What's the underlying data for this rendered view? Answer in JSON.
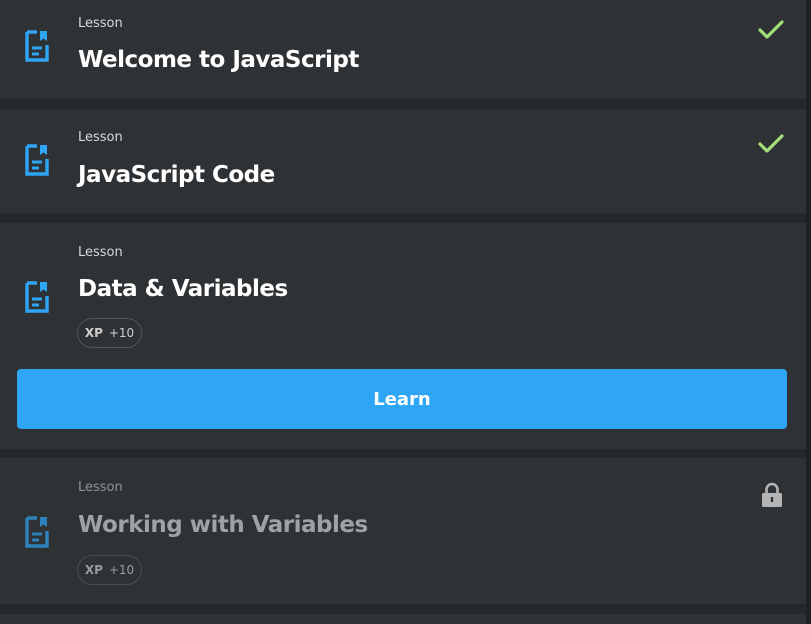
{
  "colors": {
    "accent": "#2fa5f6",
    "check": "#a3e07a",
    "lock": "#b5b5b5",
    "card": "#2e3235",
    "background": "#25282b"
  },
  "lessons": [
    {
      "kind": "Lesson",
      "title": "Welcome to JavaScript",
      "status": "completed",
      "status_icon": "check-icon"
    },
    {
      "kind": "Lesson",
      "title": "JavaScript Code",
      "status": "completed",
      "status_icon": "check-icon"
    },
    {
      "kind": "Lesson",
      "title": "Data & Variables",
      "status": "current",
      "xp_label": "XP",
      "xp_value": "+10",
      "action_label": "Learn"
    },
    {
      "kind": "Lesson",
      "title": "Working with Variables",
      "status": "locked",
      "status_icon": "lock-icon",
      "xp_label": "XP",
      "xp_value": "+10"
    }
  ]
}
